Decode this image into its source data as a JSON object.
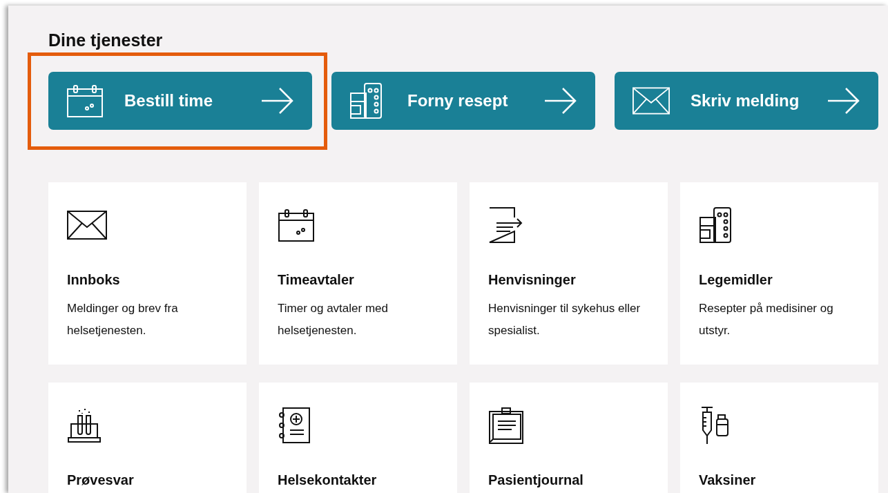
{
  "heading": "Dine tjenester",
  "quick_actions": [
    {
      "label": "Bestill time",
      "kind": "calendar",
      "highlighted": true
    },
    {
      "label": "Forny resept",
      "kind": "pills",
      "highlighted": false
    },
    {
      "label": "Skriv melding",
      "kind": "envelope",
      "highlighted": false
    }
  ],
  "services": [
    {
      "title": "Innboks",
      "description": "Meldinger og brev fra helsetjenesten.",
      "kind": "envelope"
    },
    {
      "title": "Timeavtaler",
      "description": "Timer og avtaler med helsetjenesten.",
      "kind": "calendar"
    },
    {
      "title": "Henvisninger",
      "description": "Henvisninger til sykehus eller spesialist.",
      "kind": "referral"
    },
    {
      "title": "Legemidler",
      "description": "Resepter på medisiner og utstyr.",
      "kind": "pills"
    },
    {
      "title": "Prøvesvar",
      "kind": "testtubes"
    },
    {
      "title": "Helsekontakter",
      "kind": "notebook"
    },
    {
      "title": "Pasientjournal",
      "kind": "clipboard"
    },
    {
      "title": "Vaksiner",
      "kind": "vaccine"
    }
  ]
}
